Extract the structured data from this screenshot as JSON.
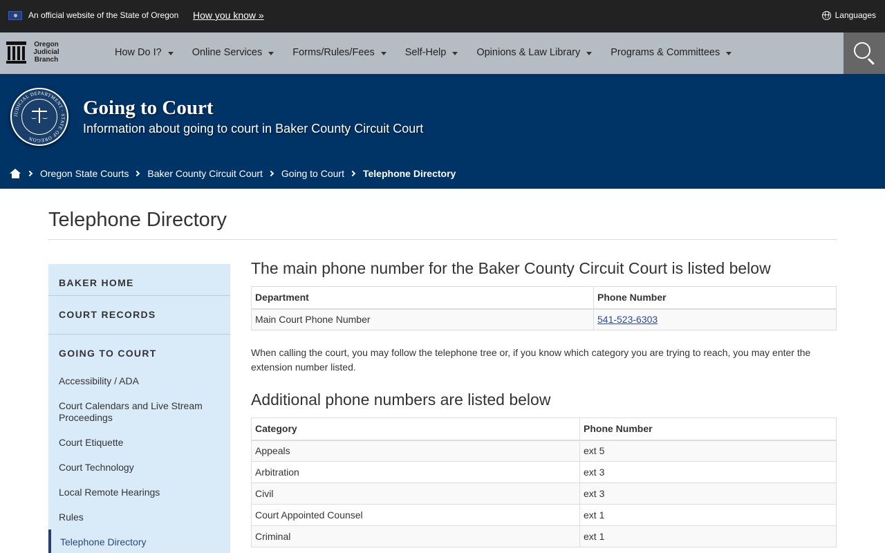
{
  "official_bar": {
    "text": "An official website of the State of Oregon",
    "how_you_know": "How you know »",
    "languages": "Languages"
  },
  "navbar": {
    "logo_lines": [
      "Oregon",
      "Judicial",
      "Branch"
    ],
    "items": [
      {
        "label": "How Do I?"
      },
      {
        "label": "Online Services"
      },
      {
        "label": "Forms/Rules/Fees"
      },
      {
        "label": "Self-Help"
      },
      {
        "label": "Opinions & Law Library"
      },
      {
        "label": "Programs & Committees"
      }
    ]
  },
  "hero": {
    "title": "Going to Court",
    "subtitle": "Information about going to court in Baker County Circuit Court",
    "seal_text": "JUDICIAL DEPARTMENT · STATE OF OREGON"
  },
  "breadcrumb": {
    "items": [
      "Oregon State Courts",
      "Baker County Circuit Court",
      "Going to Court"
    ],
    "current": "Telephone Directory"
  },
  "page": {
    "title": "Telephone Directory"
  },
  "sidebar": {
    "heads": [
      "BAKER HOME",
      "COURT RECORDS",
      "GOING TO COURT"
    ],
    "links": [
      "Accessibility / ADA",
      "Court Calendars and Live Stream Proceedings",
      "Court Etiquette",
      "Court Technology",
      "Local Remote Hearings",
      "Rules",
      "Telephone Directory"
    ],
    "active": "Telephone Directory"
  },
  "main": {
    "heading1": "The main phone number for the Baker County Circuit Court is listed below",
    "table1": {
      "headers": [
        "Department",
        "Phone Number"
      ],
      "rows": [
        [
          "Main Court Phone Number",
          "541-523-6303"
        ]
      ]
    },
    "paragraph": "When calling the court, you may follow the telephone tree or, if you know which category you are trying to reach, you may enter the extension number listed.",
    "heading2": "Additional phone numbers are listed below",
    "table2": {
      "headers": [
        "Category",
        "Phone Number"
      ],
      "rows": [
        [
          "Appeals",
          "ext 5"
        ],
        [
          "Arbitration",
          "ext 3"
        ],
        [
          "Civil",
          "ext 3"
        ],
        [
          "Court Appointed Counsel",
          "ext 1"
        ],
        [
          "Criminal",
          "ext 1"
        ]
      ]
    }
  },
  "colors": {
    "hero_bg": "#003366",
    "navbar_bg": "#b5bcc3",
    "official_bg": "#222222",
    "sidebar_bg": "#d9eaf9",
    "link": "#2a4aa0"
  },
  "icons": [
    "flag-icon",
    "globe-icon",
    "search-icon",
    "home-icon",
    "caret-down-icon",
    "chevron-right-icon",
    "seal-icon",
    "logo-icon"
  ]
}
